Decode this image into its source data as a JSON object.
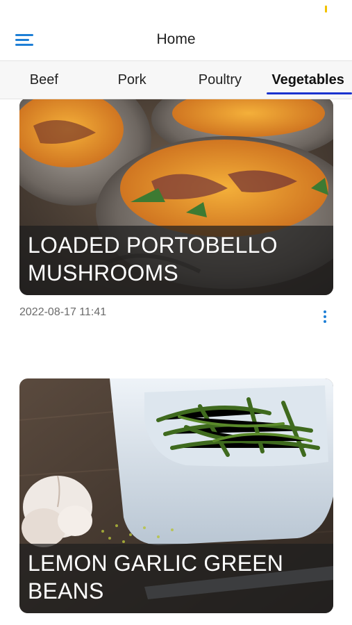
{
  "header": {
    "title": "Home"
  },
  "tabs": [
    {
      "label": "Beef"
    },
    {
      "label": "Pork"
    },
    {
      "label": "Poultry"
    },
    {
      "label": "Vegetables",
      "active": true
    }
  ],
  "cards": [
    {
      "title": "LOADED PORTOBELLO MUSHROOMS",
      "date": "2022-08-17 11:41"
    },
    {
      "title": "LEMON GARLIC GREEN BEANS"
    }
  ],
  "icons": {
    "menu": "hamburger-menu-icon",
    "more": "more-vertical-icon"
  },
  "colors": {
    "accent": "#1e7fd6",
    "tab_underline": "#1a33cf"
  }
}
